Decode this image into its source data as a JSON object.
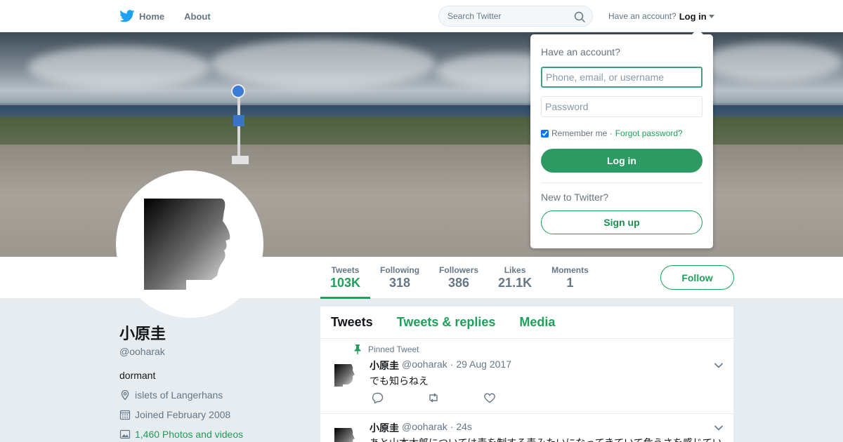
{
  "nav": {
    "home_label": "Home",
    "about_label": "About",
    "search_placeholder": "Search Twitter",
    "account_prompt": "Have an account?",
    "login_label": "Log in"
  },
  "colors": {
    "accent": "#1da05a",
    "login_button": "#2e9a63"
  },
  "profile": {
    "name": "小原圭",
    "handle": "@ooharak",
    "bio": "dormant",
    "location": "islets of Langerhans",
    "joined": "Joined February 2008",
    "media_link": "1,460 Photos and videos"
  },
  "stats": [
    {
      "label": "Tweets",
      "value": "103K"
    },
    {
      "label": "Following",
      "value": "318"
    },
    {
      "label": "Followers",
      "value": "386"
    },
    {
      "label": "Likes",
      "value": "21.1K"
    },
    {
      "label": "Moments",
      "value": "1"
    }
  ],
  "follow_label": "Follow",
  "timeline": {
    "tabs": [
      "Tweets",
      "Tweets & replies",
      "Media"
    ],
    "tweets": [
      {
        "pinned_label": "Pinned Tweet",
        "name": "小原圭",
        "handle": "@ooharak",
        "time": "· 29 Aug 2017",
        "text": "でも知らねえ"
      },
      {
        "name": "小原圭",
        "handle": "@ooharak",
        "time": "· 24s",
        "text": "あと山本太郎については毒を制する毒みたいになってきていて危うさを感じてい"
      }
    ]
  },
  "login_dropdown": {
    "title": "Have an account?",
    "username_placeholder": "Phone, email, or username",
    "password_placeholder": "Password",
    "remember_label": "Remember me ·",
    "forgot_label": "Forgot password?",
    "login_button": "Log in",
    "new_prompt": "New to Twitter?",
    "signup_button": "Sign up"
  }
}
